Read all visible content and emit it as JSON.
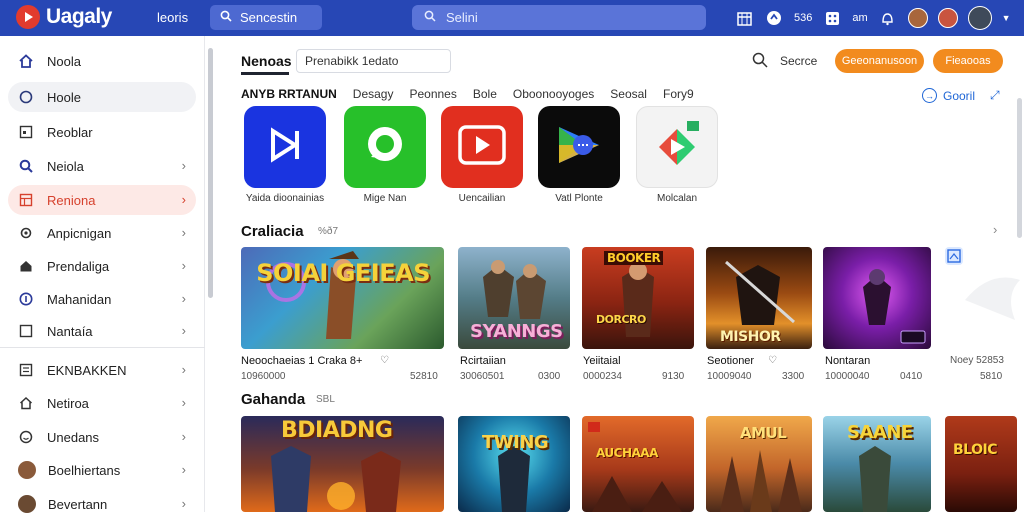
{
  "header": {
    "brand": "Uagaly",
    "link": "leoris",
    "pill_search": "Sencestin",
    "search_text": "Selini",
    "icon_text": "536",
    "icon_text2": "am",
    "color_bar": "#2747b5",
    "accent": "#f28b1e"
  },
  "sidebar": {
    "items": [
      {
        "label": "Noola",
        "icon": "home-icon"
      },
      {
        "label": "Hoole",
        "icon": "circle-icon"
      },
      {
        "label": "Reoblar",
        "icon": "square-icon"
      },
      {
        "label": "Neiola",
        "icon": "search-icon"
      },
      {
        "label": "Reniona",
        "icon": "grid-icon"
      },
      {
        "label": "Anpicnigan",
        "icon": "shield-icon"
      },
      {
        "label": "Prendaliga",
        "icon": "house-icon"
      },
      {
        "label": "Mahanidan",
        "icon": "info-icon"
      },
      {
        "label": "Nantaía",
        "icon": "square-icon"
      },
      {
        "label": "EKNBAKKEN",
        "icon": "list-icon"
      },
      {
        "label": "Netiroa",
        "icon": "house-icon"
      },
      {
        "label": "Unedans",
        "icon": "circle-icon"
      },
      {
        "label": "Boelhiertans",
        "icon": "avatar"
      },
      {
        "label": "Bevertann",
        "icon": "avatar"
      }
    ]
  },
  "content": {
    "tab": "Nenoas",
    "filter_value": "Prenabikk 1edato",
    "search_label": "Secrce",
    "btn1": "Geeonanusoon",
    "btn2": "Fieaooas",
    "categories": [
      "ANYB RRTANUN",
      "Desagy",
      "Peonnes",
      "Bole",
      "Oboonooyoges",
      "Seosal",
      "Fory9"
    ],
    "scroll_link": "Gooril",
    "apps": [
      {
        "label": "Yaida dioonainias"
      },
      {
        "label": "Mige Nan"
      },
      {
        "label": "Uencailian"
      },
      {
        "label": "Vatl Plonte"
      },
      {
        "label": "Molcalan"
      }
    ],
    "section1": {
      "title": "Craliacia",
      "sub": "%ð7"
    },
    "section2": {
      "title": "Gahanda",
      "sub": "SBL"
    },
    "games": [
      {
        "name": "Neoochaeias 1 Craka 8+",
        "meta": "10960000",
        "price": "52810",
        "art": "SOIAI GEIEAS"
      },
      {
        "name": "Rcirtaiian",
        "meta": "30060501",
        "price": "0300",
        "art": "SYANNGS"
      },
      {
        "name": "Yeiitaial",
        "meta": "0000234",
        "price": "9130",
        "art": "DORCRO"
      },
      {
        "name": "Seotioner",
        "meta": "10009040",
        "price": "3300",
        "art": "MISHOR"
      },
      {
        "name": "Nontaran",
        "meta": "10000040",
        "price": "0410",
        "art": ""
      },
      {
        "name": "Noey 52853",
        "meta": "",
        "price": "5810",
        "art": ""
      }
    ],
    "games_row2": [
      {
        "art": "BDIADNG"
      },
      {
        "art": "TWING"
      },
      {
        "art": "AUCHAAA"
      },
      {
        "art": "AMUL"
      },
      {
        "art": "SAANE"
      },
      {
        "art": "BLOIC"
      }
    ]
  }
}
